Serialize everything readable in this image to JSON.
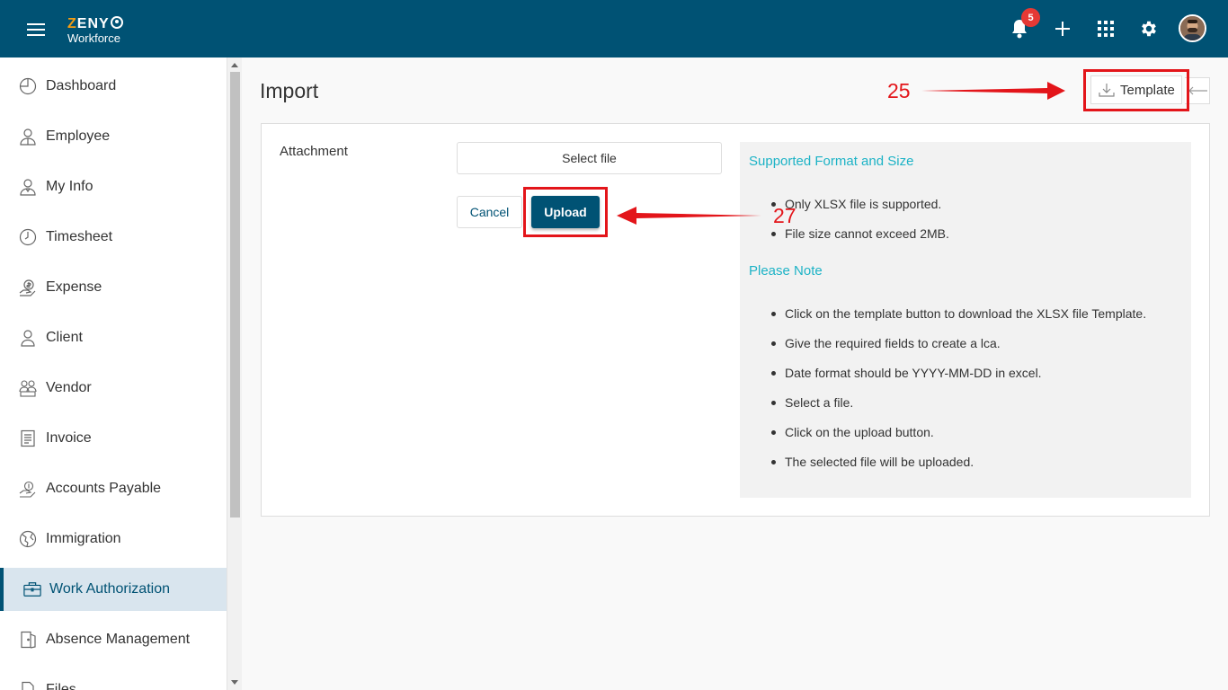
{
  "header": {
    "logo_brand": "ZENY",
    "logo_sub": "Workforce",
    "notification_count": "5",
    "icons": [
      "menu-icon",
      "bell-icon",
      "plus-icon",
      "apps-grid-icon",
      "gear-icon",
      "avatar"
    ]
  },
  "sidebar": {
    "items": [
      {
        "label": "Dashboard",
        "icon": "dashboard-icon"
      },
      {
        "label": "Employee",
        "icon": "employee-icon"
      },
      {
        "label": "My Info",
        "icon": "my-info-icon"
      },
      {
        "label": "Timesheet",
        "icon": "clock-icon"
      },
      {
        "label": "Expense",
        "icon": "expense-icon"
      },
      {
        "label": "Client",
        "icon": "client-icon"
      },
      {
        "label": "Vendor",
        "icon": "vendor-icon"
      },
      {
        "label": "Invoice",
        "icon": "invoice-icon"
      },
      {
        "label": "Accounts Payable",
        "icon": "accounts-payable-icon"
      },
      {
        "label": "Immigration",
        "icon": "globe-icon"
      },
      {
        "label": "Work Authorization",
        "icon": "briefcase-icon"
      },
      {
        "label": "Absence Management",
        "icon": "door-icon"
      },
      {
        "label": "Files",
        "icon": "file-icon"
      }
    ],
    "active_index": 10
  },
  "main": {
    "title": "Import",
    "template_button": "Template",
    "attachment_label": "Attachment",
    "select_file": "Select file",
    "cancel": "Cancel",
    "upload": "Upload",
    "info": {
      "section1_title": "Supported Format and Size",
      "section1_items": [
        "Only XLSX file is supported.",
        "File size cannot exceed 2MB."
      ],
      "section2_title": "Please Note",
      "section2_items": [
        "Click on the template button to download the XLSX file Template.",
        "Give the required fields to create a lca.",
        "Date format should be YYYY-MM-DD in excel.",
        "Select a file.",
        "Click on the upload button.",
        "The selected file will be uploaded."
      ]
    }
  },
  "annotations": {
    "label_template": "25",
    "label_upload": "27",
    "color": "#e3151a"
  },
  "colors": {
    "primary": "#005274",
    "accent_heading": "#1db3c6",
    "badge": "#e53935",
    "active_nav_bg": "#d9e5ee"
  }
}
